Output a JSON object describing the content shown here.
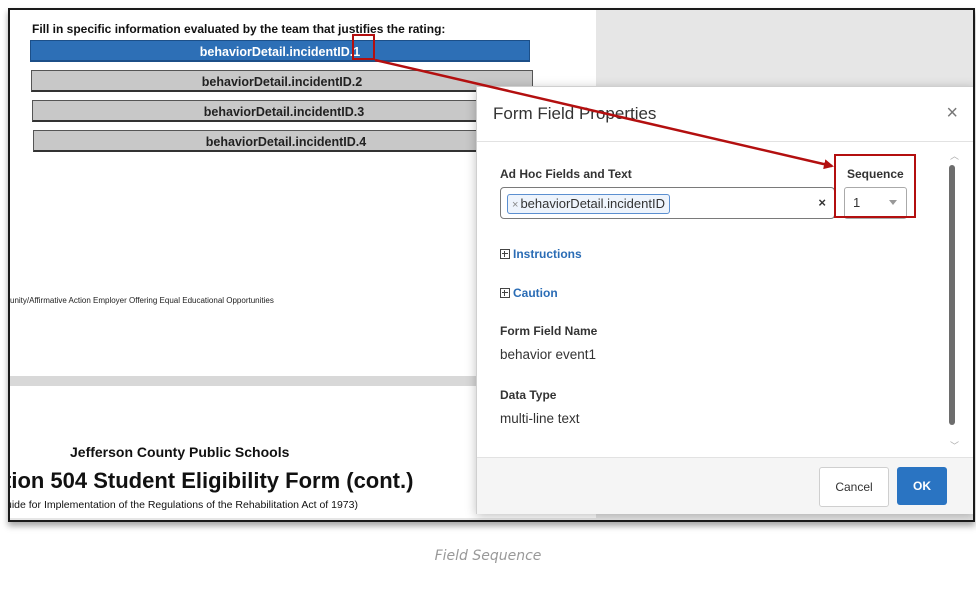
{
  "document": {
    "instruction": "Fill in specific information evaluated by the team that justifies the rating:",
    "fields": [
      {
        "label": "behaviorDetail.incidentID.1"
      },
      {
        "label": "behaviorDetail.incidentID.2"
      },
      {
        "label": "behaviorDetail.incidentID.3"
      },
      {
        "label": "behaviorDetail.incidentID.4"
      }
    ],
    "footer_note": "unity/Affirmative Action Employer Offering Equal Educational Opportunities",
    "org": "Jefferson County Public Schools",
    "form_title": "tion 504 Student Eligibility Form (cont.)",
    "form_subtitle": "uide for Implementation of the Regulations of the Rehabilitation Act of 1973)"
  },
  "dialog": {
    "title": "Form Field Properties",
    "adhoc_label": "Ad Hoc Fields and Text",
    "adhoc_chip": "behaviorDetail.incidentID",
    "sequence_label": "Sequence",
    "sequence_value": "1",
    "instructions_label": "Instructions",
    "caution_label": "Caution",
    "form_field_name_label": "Form Field Name",
    "form_field_name_value": "behavior event1",
    "data_type_label": "Data Type",
    "data_type_value": "multi-line text",
    "cancel_label": "Cancel",
    "ok_label": "OK"
  },
  "caption": "Field Sequence",
  "colors": {
    "highlight": "#b30f0f",
    "primary": "#2a74c2",
    "link": "#2a6cb5"
  }
}
